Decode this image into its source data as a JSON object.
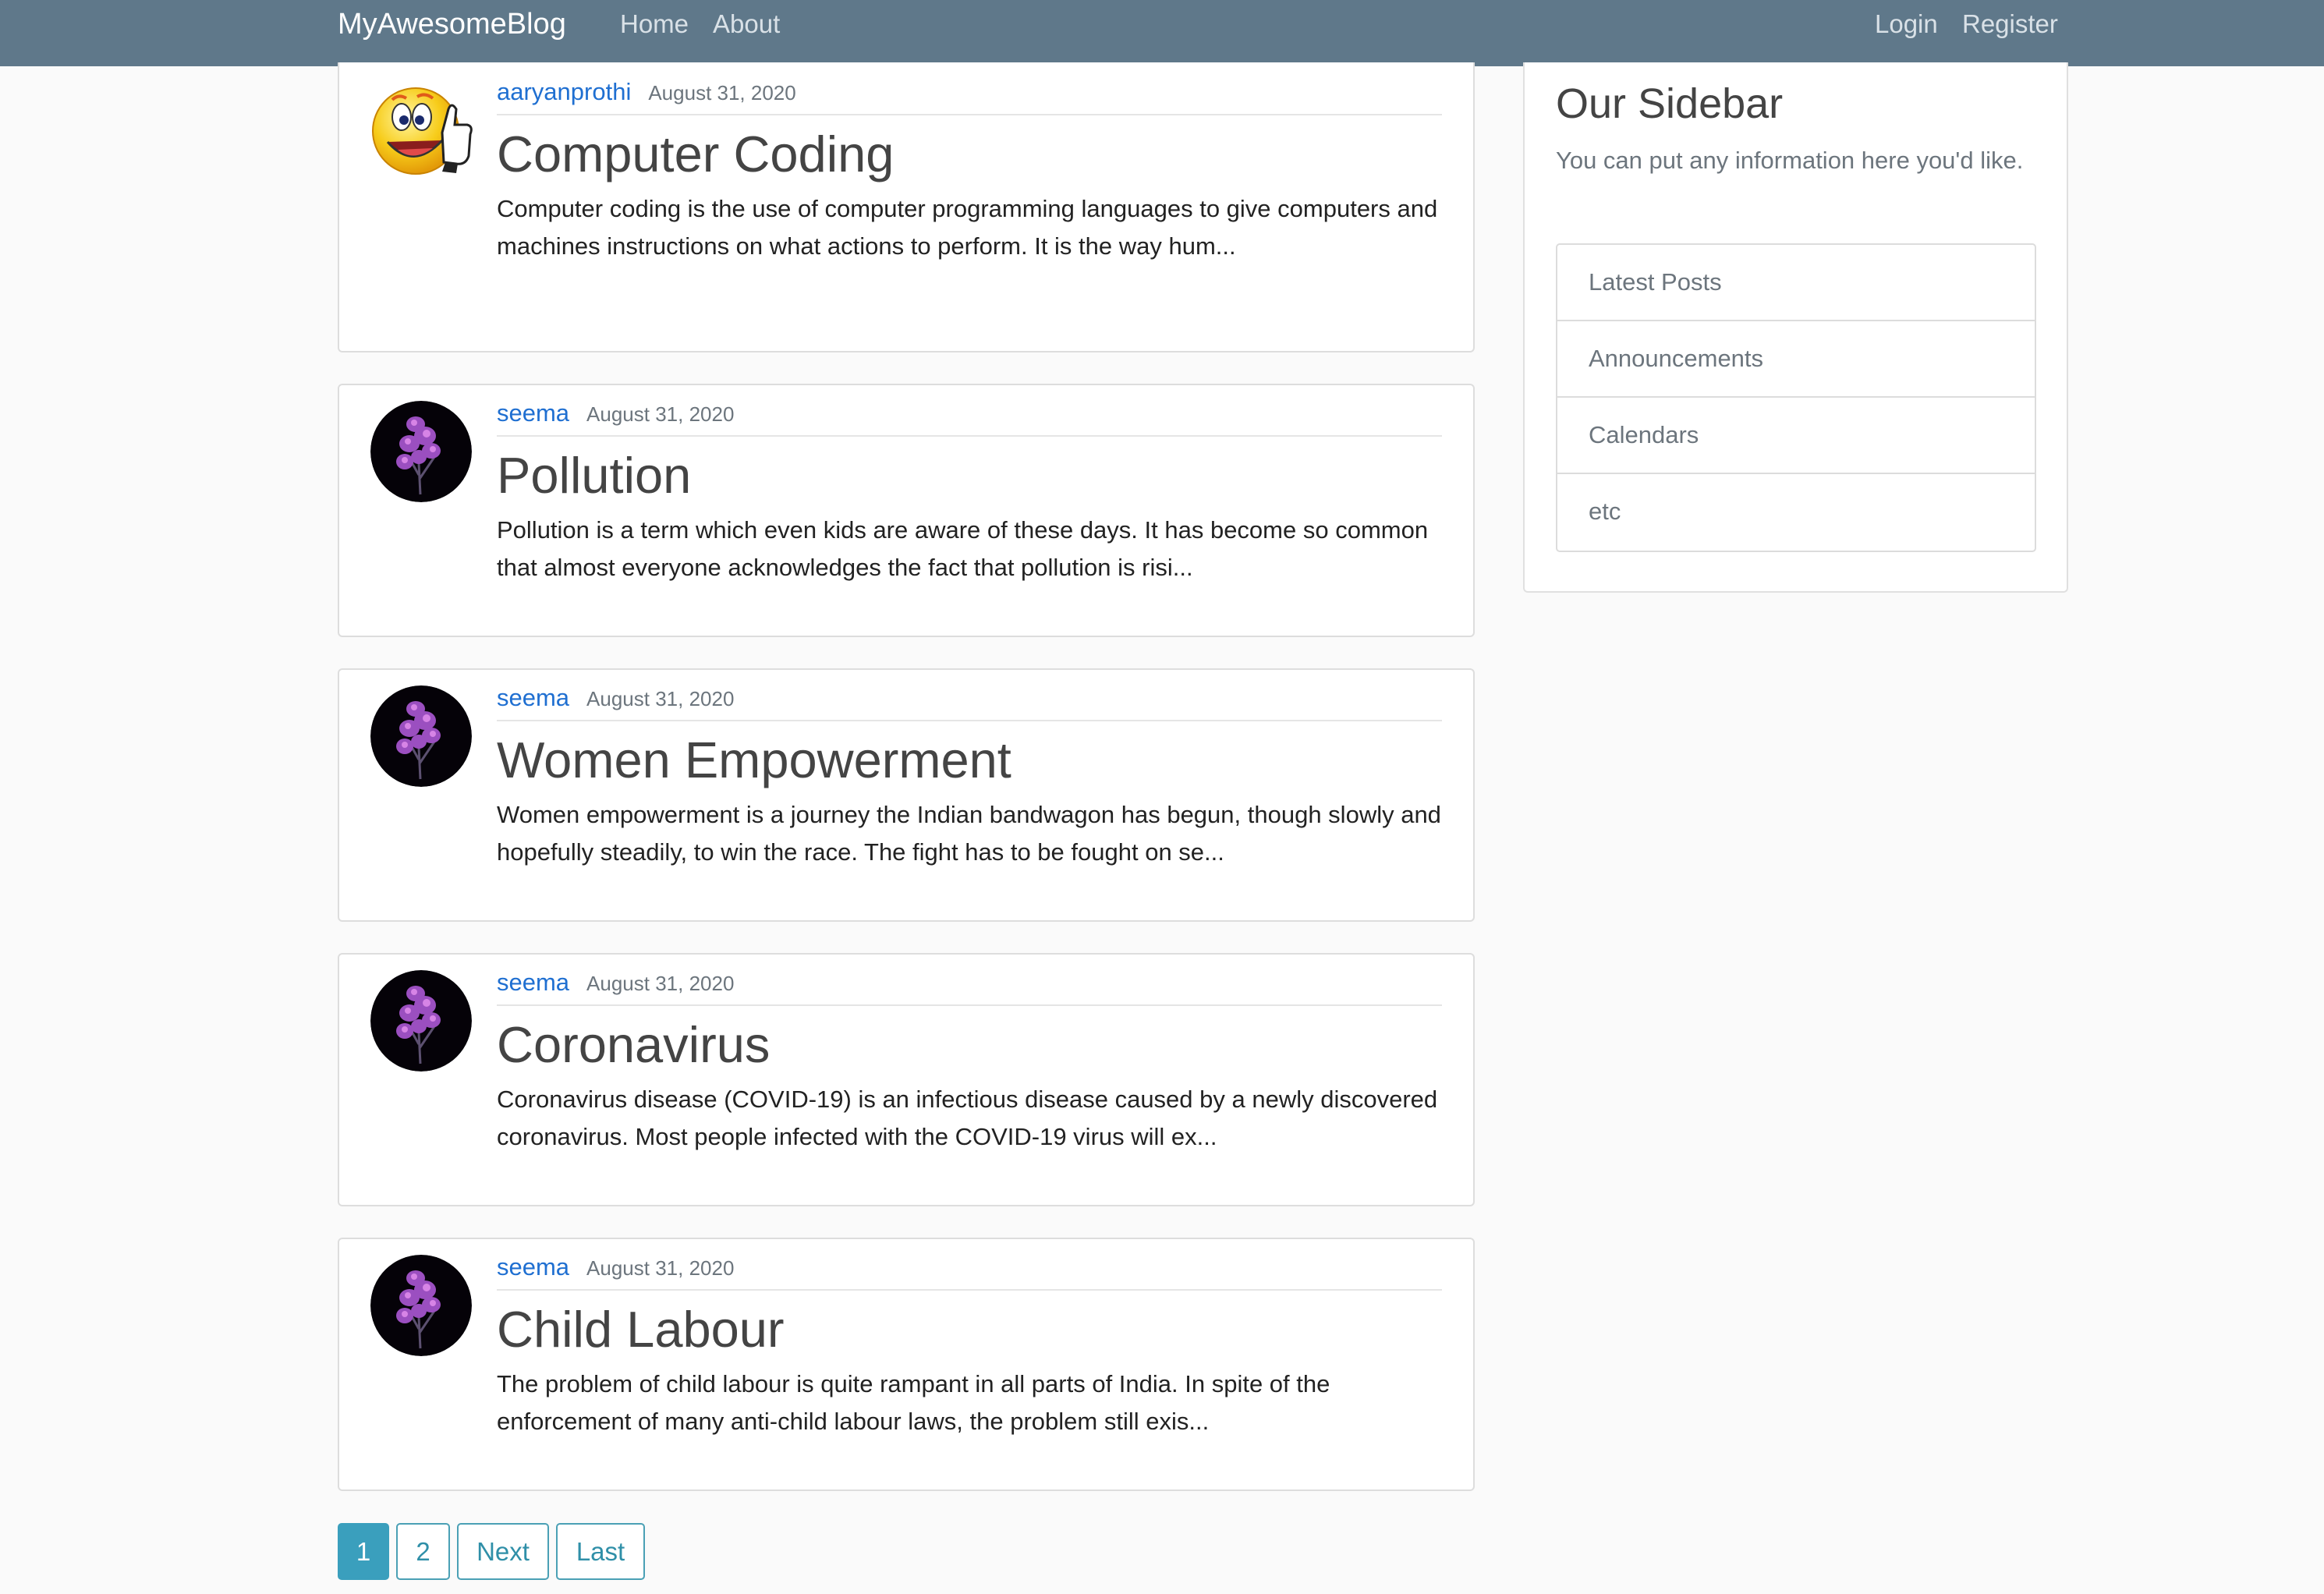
{
  "navbar": {
    "brand": "MyAwesomeBlog",
    "links": [
      "Home",
      "About"
    ],
    "auth_links": [
      "Login",
      "Register"
    ],
    "background": "#5f788a"
  },
  "posts": [
    {
      "author": "aaryanprothi",
      "date": "August 31, 2020",
      "title": "Computer Coding",
      "excerpt": "Computer coding is the use of computer programming languages to give computers and machines instructions on what actions to perform. It is the way hum...",
      "avatar": "smiley-thumbs-up-icon"
    },
    {
      "author": "seema",
      "date": "August 31, 2020",
      "title": "Pollution",
      "excerpt": "Pollution is a term which even kids are aware of these days. It has become so common that almost everyone acknowledges the fact that pollution is risi...",
      "avatar": "purple-flower-icon"
    },
    {
      "author": "seema",
      "date": "August 31, 2020",
      "title": "Women Empowerment",
      "excerpt": "Women empowerment is a journey the Indian bandwagon has begun, though slowly and hopefully steadily, to win the race. The fight has to be fought on se...",
      "avatar": "purple-flower-icon"
    },
    {
      "author": "seema",
      "date": "August 31, 2020",
      "title": "Coronavirus",
      "excerpt": "Coronavirus disease (COVID-19) is an infectious disease caused by a newly discovered coronavirus. Most people infected with the COVID-19 virus will ex...",
      "avatar": "purple-flower-icon"
    },
    {
      "author": "seema",
      "date": "August 31, 2020",
      "title": "Child Labour",
      "excerpt": "The problem of child labour is quite rampant in all parts of India. In spite of the enforcement of many anti-child labour laws, the problem still exis...",
      "avatar": "purple-flower-icon"
    }
  ],
  "pagination": {
    "pages": [
      "1",
      "2"
    ],
    "current": "1",
    "next_label": "Next",
    "last_label": "Last",
    "accent": "#3a9fbd"
  },
  "sidebar": {
    "title": "Our Sidebar",
    "text": "You can put any information here you'd like.",
    "items": [
      "Latest Posts",
      "Announcements",
      "Calendars",
      "etc"
    ]
  }
}
